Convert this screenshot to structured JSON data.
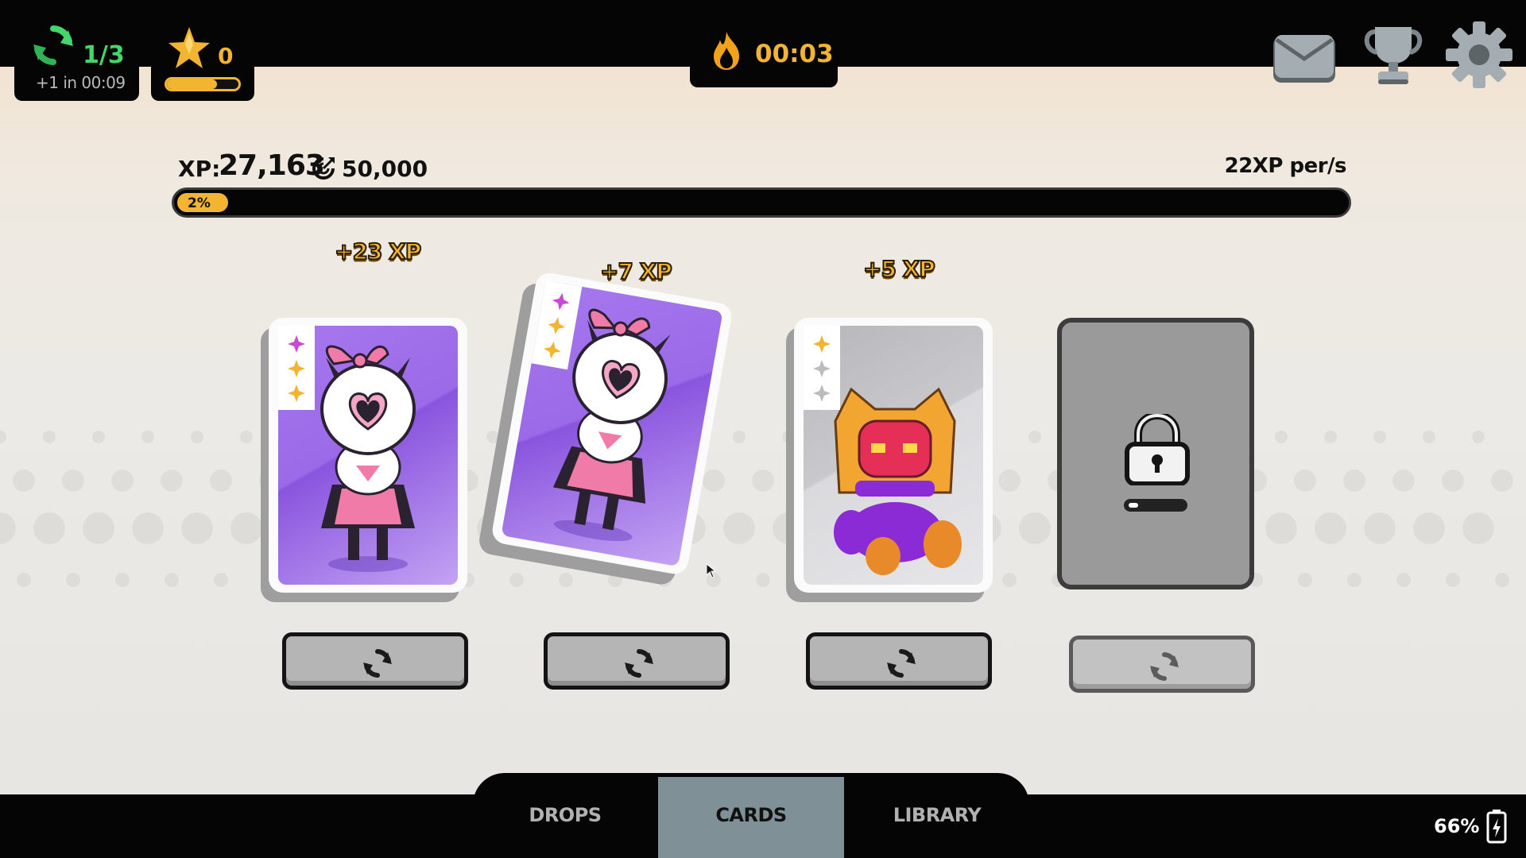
{
  "hud": {
    "turns": {
      "count": "1/3",
      "refill": "+1 in 00:09",
      "icon": "refresh-icon"
    },
    "stars": {
      "count": "0",
      "progress": 0.7,
      "icon": "star-icon"
    },
    "timer": {
      "value": "00:03",
      "icon": "flame-icon"
    },
    "buttons": [
      "mail-icon",
      "trophy-icon",
      "gear-icon"
    ]
  },
  "xp": {
    "label": "XP:",
    "value": "27,163",
    "goal": "50,000",
    "rate": "22XP per/s",
    "percent_label": "2%",
    "percent": 2
  },
  "cards": [
    {
      "xp_popup": "+23 XP",
      "art": "pink-cat-girl",
      "rarity": [
        "magenta",
        "gold",
        "gold"
      ]
    },
    {
      "xp_popup": "+7 XP",
      "art": "pink-cat-girl",
      "rarity": [
        "magenta",
        "gold",
        "gold"
      ]
    },
    {
      "xp_popup": "+5 XP",
      "art": "hooded-creature",
      "rarity": [
        "gold",
        "silver",
        "silver"
      ]
    },
    {
      "locked": true,
      "icon": "lock-icon"
    }
  ],
  "reroll_icon": "refresh-icon",
  "nav": {
    "tabs": [
      {
        "label": "DROPS",
        "active": false
      },
      {
        "label": "CARDS",
        "active": true
      },
      {
        "label": "LIBRARY",
        "active": false
      }
    ]
  },
  "status": {
    "battery": "66%"
  },
  "colors": {
    "gold": "#f2b431",
    "green": "#44d66a",
    "purple": "#9b6ae8",
    "active_tab": "#7f9196"
  }
}
